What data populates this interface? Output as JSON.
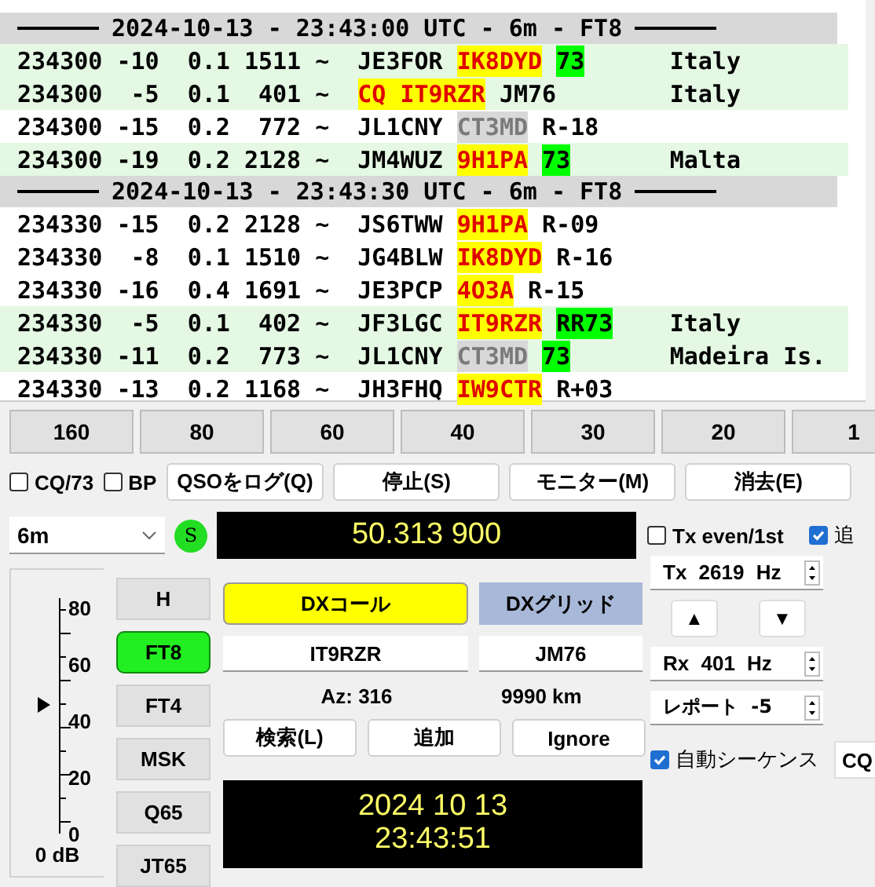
{
  "decodes": [
    {
      "kind": "separator",
      "text": "2024-10-13 - 23:43:00 UTC - 6m - FT8"
    },
    {
      "kind": "decode",
      "highlighted": true,
      "time": "234300",
      "snr": "-10",
      "dt": "0.1",
      "freq": "1511",
      "mode": "~",
      "message": [
        {
          "text": "JE3FOR",
          "kind": "plain"
        },
        {
          "text": "IK8DYD",
          "kind": "new"
        },
        {
          "text": "73",
          "kind": "end"
        }
      ],
      "country": "Italy"
    },
    {
      "kind": "decode",
      "highlighted": true,
      "time": "234300",
      "snr": "-5",
      "dt": "0.1",
      "freq": "401",
      "mode": "~",
      "message": [
        {
          "text": "CQ IT9RZR",
          "kind": "new"
        },
        {
          "text": "JM76",
          "kind": "plain"
        }
      ],
      "country": "Italy"
    },
    {
      "kind": "decode",
      "highlighted": false,
      "time": "234300",
      "snr": "-15",
      "dt": "0.2",
      "freq": "772",
      "mode": "~",
      "message": [
        {
          "text": "JL1CNY",
          "kind": "plain"
        },
        {
          "text": "CT3MD",
          "kind": "worked"
        },
        {
          "text": "R-18",
          "kind": "plain"
        }
      ]
    },
    {
      "kind": "decode",
      "highlighted": true,
      "time": "234300",
      "snr": "-19",
      "dt": "0.2",
      "freq": "2128",
      "mode": "~",
      "message": [
        {
          "text": "JM4WUZ",
          "kind": "plain"
        },
        {
          "text": "9H1PA",
          "kind": "new"
        },
        {
          "text": "73",
          "kind": "end"
        }
      ],
      "country": "Malta"
    },
    {
      "kind": "separator",
      "text": "2024-10-13 - 23:43:30 UTC - 6m - FT8"
    },
    {
      "kind": "decode",
      "highlighted": false,
      "time": "234330",
      "snr": "-15",
      "dt": "0.2",
      "freq": "2128",
      "mode": "~",
      "message": [
        {
          "text": "JS6TWW",
          "kind": "plain"
        },
        {
          "text": "9H1PA",
          "kind": "new"
        },
        {
          "text": "R-09",
          "kind": "plain"
        }
      ]
    },
    {
      "kind": "decode",
      "highlighted": false,
      "time": "234330",
      "snr": "-8",
      "dt": "0.1",
      "freq": "1510",
      "mode": "~",
      "message": [
        {
          "text": "JG4BLW",
          "kind": "plain"
        },
        {
          "text": "IK8DYD",
          "kind": "new"
        },
        {
          "text": "R-16",
          "kind": "plain"
        }
      ]
    },
    {
      "kind": "decode",
      "highlighted": false,
      "time": "234330",
      "snr": "-16",
      "dt": "0.4",
      "freq": "1691",
      "mode": "~",
      "message": [
        {
          "text": "JE3PCP",
          "kind": "plain"
        },
        {
          "text": "4O3A",
          "kind": "new"
        },
        {
          "text": "R-15",
          "kind": "plain"
        }
      ]
    },
    {
      "kind": "decode",
      "highlighted": true,
      "time": "234330",
      "snr": "-5",
      "dt": "0.1",
      "freq": "402",
      "mode": "~",
      "message": [
        {
          "text": "JF3LGC",
          "kind": "plain"
        },
        {
          "text": "IT9RZR",
          "kind": "new"
        },
        {
          "text": "RR73",
          "kind": "end"
        }
      ],
      "country": "Italy"
    },
    {
      "kind": "decode",
      "highlighted": true,
      "time": "234330",
      "snr": "-11",
      "dt": "0.2",
      "freq": "773",
      "mode": "~",
      "message": [
        {
          "text": "JL1CNY",
          "kind": "plain"
        },
        {
          "text": "CT3MD",
          "kind": "worked"
        },
        {
          "text": "73",
          "kind": "end"
        }
      ],
      "country": "Madeira Is."
    },
    {
      "kind": "decode",
      "highlighted": false,
      "time": "234330",
      "snr": "-13",
      "dt": "0.2",
      "freq": "1168",
      "mode": "~",
      "message": [
        {
          "text": "JH3FHQ",
          "kind": "plain"
        },
        {
          "text": "IW9CTR",
          "kind": "new"
        },
        {
          "text": "R+03",
          "kind": "plain"
        }
      ]
    }
  ],
  "band_buttons": [
    "160",
    "80",
    "60",
    "40",
    "30",
    "20",
    "1"
  ],
  "controls": [
    {
      "kind": "checkbox",
      "label": "CQ/73",
      "checked": false
    },
    {
      "kind": "checkbox",
      "label": "BP",
      "checked": false
    },
    {
      "kind": "button",
      "label": "QSOをログ(Q)"
    },
    {
      "kind": "button",
      "label": "停止(S)"
    },
    {
      "kind": "button",
      "label": "モニター(M)"
    },
    {
      "kind": "button",
      "label": "消去(E)"
    }
  ],
  "band_select": "6m",
  "status_indicator": "S",
  "frequency": "50.313 900",
  "tx_even": {
    "label": "Tx even/1st",
    "checked": false
  },
  "cut_checkbox": {
    "label": "追",
    "checked": true
  },
  "meter": {
    "ticks": [
      "80",
      "60",
      "40",
      "20",
      "0"
    ],
    "level": 0.55,
    "reading": "0 dB"
  },
  "modes": [
    {
      "label": "H",
      "selected": false
    },
    {
      "label": "FT8",
      "selected": true
    },
    {
      "label": "FT4",
      "selected": false
    },
    {
      "label": "MSK",
      "selected": false
    },
    {
      "label": "Q65",
      "selected": false
    },
    {
      "label": "JT65",
      "selected": false
    }
  ],
  "dx": {
    "call_button": "DXコール",
    "grid_button": "DXグリッド",
    "call": "IT9RZR",
    "grid": "JM76",
    "azimuth": "Az: 316",
    "distance": "9990 km"
  },
  "dx_buttons": [
    "検索(L)",
    "追加",
    "Ignore"
  ],
  "clock": {
    "date": "2024 10 13",
    "time": "23:43:51"
  },
  "tx_freq": "Tx 2619 Hz",
  "arrows": [
    "▲",
    "▼"
  ],
  "rx_freq": "Rx 401 Hz",
  "report": "レポート -5",
  "auto_sequence": {
    "label": "自動シーケンス",
    "checked": true
  },
  "cq_button": "CQ"
}
